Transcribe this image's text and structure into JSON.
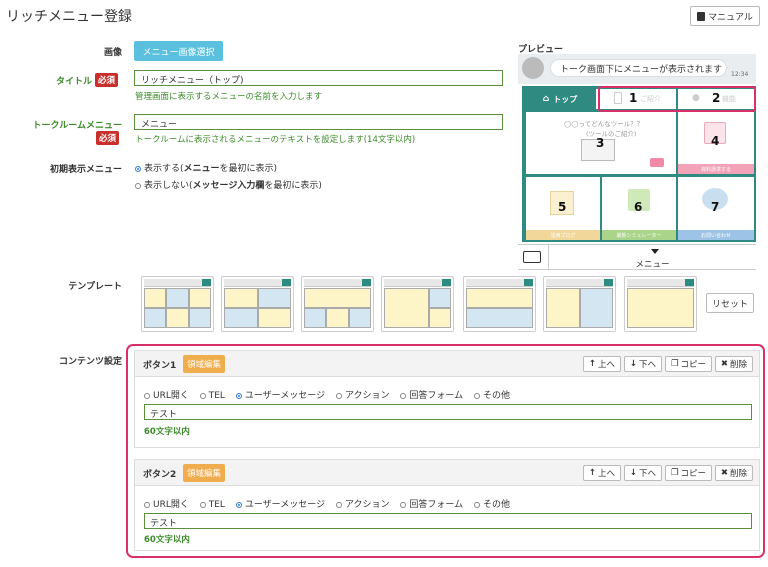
{
  "page": {
    "title": "リッチメニュー登録",
    "manual_label": "マニュアル"
  },
  "form": {
    "image_label": "画像",
    "image_button": "メニュー画像選択",
    "title_label": "タイトル",
    "required": "必須",
    "title_value": "リッチメニュー（トップ)",
    "title_help": "管理画面に表示するメニューの名前を入力します",
    "talk_label": "トークルームメニュー",
    "talk_value": "メニュー",
    "talk_help": "トークルームに表示されるメニューのテキストを設定します(14文字以内)",
    "initial_label": "初期表示メニュー",
    "initial_options": [
      {
        "pre": "表示する(",
        "bold": "メニュー",
        "post": "を最初に表示)",
        "selected": true
      },
      {
        "pre": "表示しない(",
        "bold": "メッセージ入力欄",
        "post": "を最初に表示)",
        "selected": false
      }
    ],
    "template_label": "テンプレート",
    "reset_label": "リセット",
    "content_label": "コンテンツ設定"
  },
  "preview": {
    "title": "プレビュー",
    "bubble_text": "トーク画面下にメニューが表示されます",
    "time": "12:34",
    "tab_top": "トップ",
    "tab1_text": "ご紹介",
    "tab2_text": "機能",
    "num1": "1",
    "num2": "2",
    "cell3_text1": "◯◯ってどんなツール？？",
    "cell3_text2": "(ツールのご紹介)",
    "num3": "3",
    "num4": "4",
    "cell4_strip": "資料請求する",
    "num5": "5",
    "cell5_strip": "活用ブログ",
    "num6": "6",
    "cell6_strip": "最新シミュレーター",
    "num7": "7",
    "cell7_strip": "お問い合わせ",
    "menu_label": "メニュー",
    "colors": {
      "teal": "#2f8a82",
      "pink": "#d9306b"
    }
  },
  "buttons": [
    {
      "title": "ボタン1",
      "area_edit": "領域編集",
      "tools": {
        "up": "上へ",
        "down": "下へ",
        "copy": "コピー",
        "delete": "削除"
      },
      "options": [
        "URL開く",
        "TEL",
        "ユーザーメッセージ",
        "アクション",
        "回答フォーム",
        "その他"
      ],
      "selected": "ユーザーメッセージ",
      "text_value": "テスト",
      "limit": "60文字以内"
    },
    {
      "title": "ボタン2",
      "area_edit": "領域編集",
      "tools": {
        "up": "上へ",
        "down": "下へ",
        "copy": "コピー",
        "delete": "削除"
      },
      "options": [
        "URL開く",
        "TEL",
        "ユーザーメッセージ",
        "アクション",
        "回答フォーム",
        "その他"
      ],
      "selected": "ユーザーメッセージ",
      "text_value": "テスト",
      "limit": "60文字以内"
    }
  ]
}
